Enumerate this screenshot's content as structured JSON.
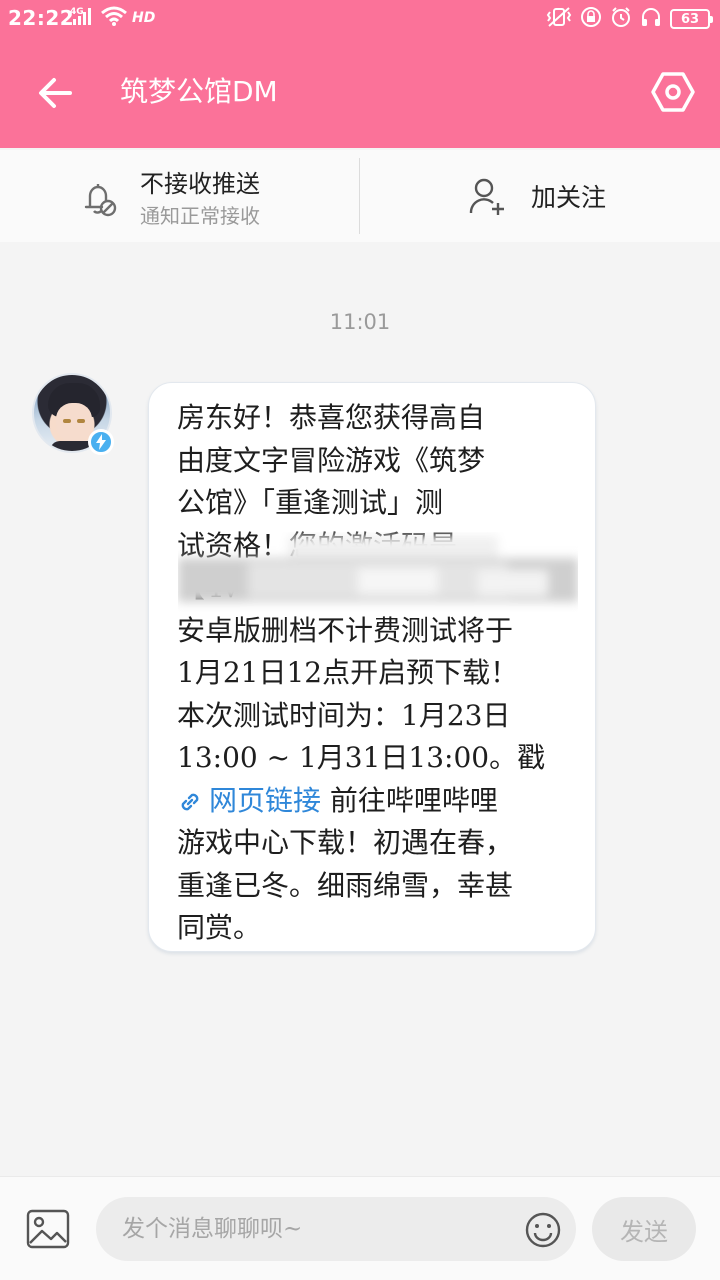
{
  "status_bar": {
    "time": "22:22",
    "network": "4G",
    "hd": "HD",
    "battery": "63"
  },
  "header": {
    "title": "筑梦公馆DM",
    "back_icon": "arrow-left-icon",
    "settings_icon": "hexagon-settings-icon",
    "bg_color": "#fb7299"
  },
  "actions": {
    "push_title": "不接收推送",
    "push_subtitle": "通知正常接收",
    "follow_label": "加关注"
  },
  "chat": {
    "timestamp": "11:01",
    "message_lines": [
      "房东好！恭喜您获得高自",
      "由度文字冒险游戏《筑梦",
      "公馆》「重逢测试」测",
      "试资格！您的激活码是",
      "【4v",
      "安卓版删档不计费测试将于",
      "1月21日12点开启预下载！",
      "本次测试时间为：1月23日",
      "13:00 ~ 1月31日13:00。戳"
    ],
    "link_text": "网页链接",
    "after_link": " 前往哔哩哔哩",
    "tail_lines": [
      "游戏中心下载！初遇在春，",
      "重逢已冬。细雨绵雪，幸甚",
      "同赏。"
    ],
    "link_color": "#2f87d9"
  },
  "composer": {
    "placeholder": "发个消息聊聊呗~",
    "send_label": "发送"
  }
}
